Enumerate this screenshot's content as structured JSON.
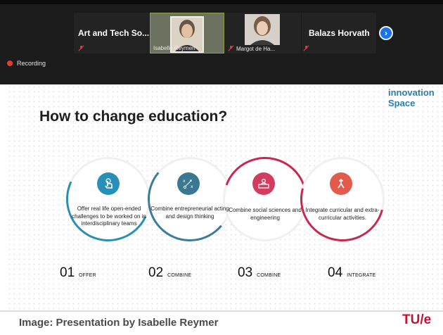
{
  "call": {
    "tiles": [
      {
        "name": "Art and Tech So..."
      },
      {
        "caption": "Isabelle Reymen"
      },
      {
        "caption": "Margot de Ha..."
      },
      {
        "name": "Balazs Horvath"
      }
    ],
    "recording_label": "Recording",
    "next_icon": "chevron-right-icon",
    "mic_icon": "mic-muted-icon"
  },
  "slide": {
    "logo_line1": "innovation",
    "logo_line2": "Space",
    "title": "How to change education?",
    "cards": [
      {
        "icon": "hand-touch-icon",
        "text": "Offer real life open-ended challenges to be worked on in interdisciplinary teams",
        "number": "01",
        "word": "OFFER"
      },
      {
        "icon": "strategy-icon",
        "text": "Combine entrepreneurial acting and design thinking",
        "number": "02",
        "word": "COMBINE"
      },
      {
        "icon": "presenter-icon",
        "text": "Combine social sciences and engineering",
        "number": "03",
        "word": "COMBINE"
      },
      {
        "icon": "merge-arrows-icon",
        "text": "Integrate curricular and extra-curricular activities.",
        "number": "04",
        "word": "INTEGRATE"
      }
    ]
  },
  "footer": {
    "caption": "Image: Presentation by Isabelle Reymer",
    "brand": "TU/e"
  },
  "colors": {
    "teal": "#2890b8",
    "slate": "#3a7892",
    "crimson": "#d43c5f",
    "coral": "#e35b4d",
    "tue_red": "#c8102e"
  }
}
